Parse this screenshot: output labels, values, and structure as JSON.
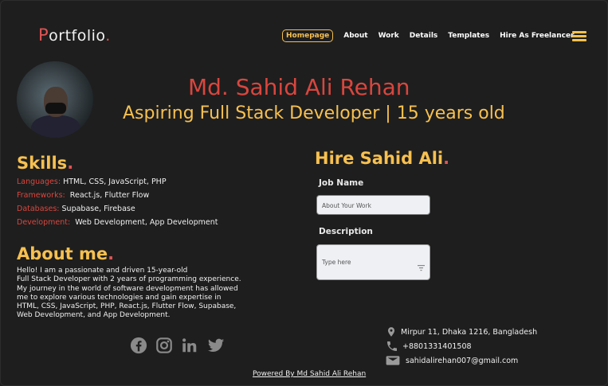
{
  "logo": {
    "first": "P",
    "rest": "ortfolio",
    "dot": "."
  },
  "nav": {
    "items": [
      {
        "label": "Homepage"
      },
      {
        "label": "About"
      },
      {
        "label": "Work"
      },
      {
        "label": "Details"
      },
      {
        "label": "Templates"
      },
      {
        "label": "Hire As Freelancer"
      }
    ],
    "active_index": 0,
    "menu_icon": "hamburger-menu-icon"
  },
  "hero": {
    "name": "Md. Sahid Ali Rehan",
    "tagline": "Aspiring Full Stack Developer | 15 years old"
  },
  "skills": {
    "title": "Skills",
    "dot": ".",
    "rows": [
      {
        "key": "Languages:",
        "value": "HTML, CSS, JavaScript, PHP"
      },
      {
        "key": "Frameworks:",
        "value": "React.js, Flutter Flow"
      },
      {
        "key": "Databases:",
        "value": "Supabase, Firebase"
      },
      {
        "key": "Development:",
        "value": "Web Development, App Development"
      }
    ]
  },
  "about": {
    "title": "About me",
    "dot": ".",
    "lines": [
      "Hello! I am a passionate and driven 15-year-old",
      "Full Stack Developer with 2 years of programming experience.",
      "My journey in the world of software development has allowed",
      "me to explore various technologies and gain expertise in",
      "HTML, CSS, JavaScript, PHP, React.js, Flutter Flow, Supabase,",
      "Web Development, and App Development."
    ]
  },
  "social": [
    "facebook-icon",
    "instagram-icon",
    "linkedin-icon",
    "twitter-icon"
  ],
  "hire": {
    "title": "Hire Sahid Ali",
    "dot": ".",
    "job_label": "Job Name",
    "job_placeholder": "About Your Work",
    "desc_label": "Description",
    "desc_placeholder": "Type here"
  },
  "contact": {
    "address": "Mirpur 11, Dhaka 1216, Bangladesh",
    "phone": "+8801331401508",
    "email": "sahidalirehan007@gmail.com"
  },
  "footer": {
    "text": "Powered By Md Sahid Ali Rehan"
  },
  "colors": {
    "background": "#1e1e1e",
    "accent_red": "#d9463e",
    "accent_yellow": "#f7c050"
  }
}
